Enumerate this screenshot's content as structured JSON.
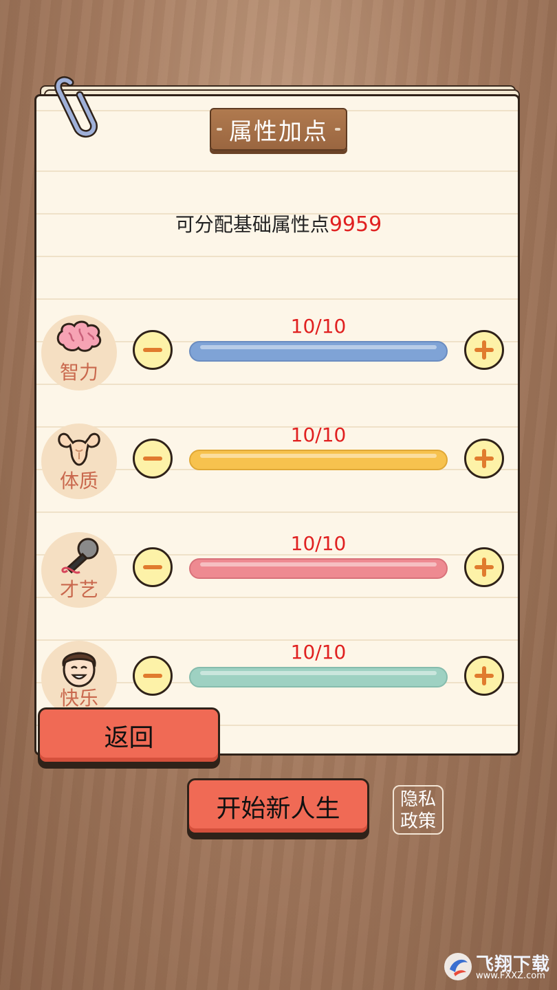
{
  "header": {
    "title": "属性加点"
  },
  "points": {
    "label": "可分配基础属性点",
    "value": "9959"
  },
  "attributes": [
    {
      "label": "智力",
      "icon": "brain-icon",
      "value_text": "10/10",
      "fill": 1.0,
      "color": "#7fa3d6"
    },
    {
      "label": "体质",
      "icon": "muscle-icon",
      "value_text": "10/10",
      "fill": 1.0,
      "color": "#f7c24e"
    },
    {
      "label": "才艺",
      "icon": "microphone-icon",
      "value_text": "10/10",
      "fill": 1.0,
      "color": "#ee8a91"
    },
    {
      "label": "快乐",
      "icon": "smiling-face-icon",
      "value_text": "10/10",
      "fill": 1.0,
      "color": "#9ed1c2"
    }
  ],
  "buttons": {
    "back": "返回",
    "start": "开始新人生",
    "privacy_line1": "隐私",
    "privacy_line2": "政策"
  },
  "watermark": {
    "brand": "飞翔下载",
    "url": "www.FXXZ.com"
  },
  "colors": {
    "accent_red": "#e02020",
    "button_red": "#f06a55",
    "plus_minus_orange": "#e07b2e"
  }
}
